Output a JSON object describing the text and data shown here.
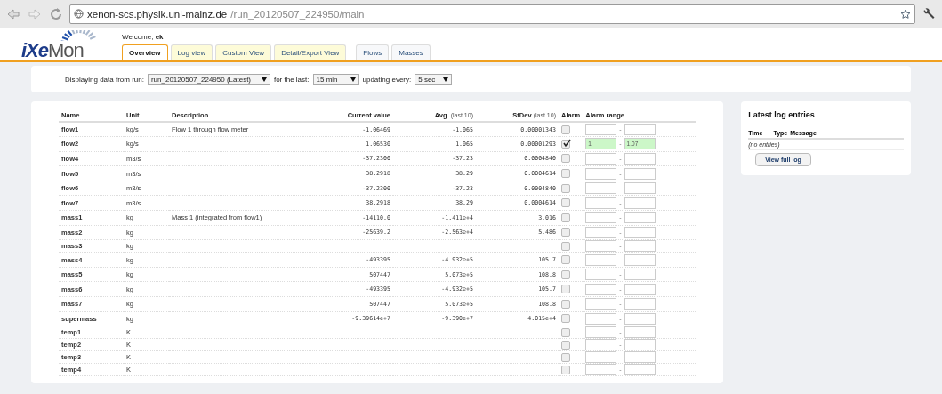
{
  "browser": {
    "url_host": "xenon-scs.physik.uni-mainz.de",
    "url_path": "/run_20120507_224950/main"
  },
  "header": {
    "logo": {
      "prefix": "iXe",
      "suffix": "Mon"
    },
    "welcome": "Welcome,",
    "user": "ek"
  },
  "tabs": [
    {
      "label": "Overview",
      "kind": "view",
      "selected": true
    },
    {
      "label": "Log view",
      "kind": "view",
      "selected": false
    },
    {
      "label": "Custom View",
      "kind": "view",
      "selected": false
    },
    {
      "label": "Detail/Export View",
      "kind": "view",
      "selected": false
    },
    {
      "label": "Flows",
      "kind": "group",
      "selected": false
    },
    {
      "label": "Masses",
      "kind": "group",
      "selected": false
    }
  ],
  "controls": {
    "run_label": "Displaying data from run:",
    "run": "run_20120507_224950 (Latest)",
    "last_label": "for the last:",
    "last": "15 min",
    "update_label": "updating every:",
    "update": "5 sec"
  },
  "table": {
    "columns": [
      {
        "label": "Name"
      },
      {
        "label": "Unit"
      },
      {
        "label": "Description"
      },
      {
        "label": "Current value"
      },
      {
        "label": "Avg.",
        "note": "(last 10)"
      },
      {
        "label": "StDev",
        "note": "(last 10)"
      },
      {
        "label": "Alarm"
      },
      {
        "label": "Alarm range"
      }
    ],
    "rows": [
      {
        "name": "flow1",
        "unit": "kg/s",
        "description": "Flow 1 through flow meter",
        "current": "-1.06469",
        "avg": "-1.065",
        "stdev": "0.00001343",
        "alarm": false,
        "separator": "-"
      },
      {
        "name": "flow2",
        "unit": "kg/s",
        "current": "1.06530",
        "avg": "1.065",
        "stdev": "0.00001293",
        "alarm": true,
        "alarm_low": "1",
        "separator": "-",
        "alarm_high": "1.07"
      },
      {
        "name": "flow4",
        "unit": "m3/s",
        "current": "-37.2300",
        "avg": "-37.23",
        "stdev": "0.0004840",
        "alarm": false,
        "separator": "-"
      },
      {
        "name": "flow5",
        "unit": "m3/s",
        "current": "38.2918",
        "avg": "38.29",
        "stdev": "0.0004614",
        "alarm": false,
        "separator": "-"
      },
      {
        "name": "flow6",
        "unit": "m3/s",
        "current": "-37.2300",
        "avg": "-37.23",
        "stdev": "0.0004840",
        "alarm": false,
        "separator": "-"
      },
      {
        "name": "flow7",
        "unit": "m3/s",
        "current": "38.2918",
        "avg": "38.29",
        "stdev": "0.0004614",
        "alarm": false,
        "separator": "-"
      },
      {
        "name": "mass1",
        "unit": "kg",
        "description": "Mass 1 (integrated from flow1)",
        "current": "-14110.0",
        "avg": "-1.411e+4",
        "stdev": "3.016",
        "alarm": false,
        "separator": "-"
      },
      {
        "name": "mass2",
        "unit": "kg",
        "current": "-25639.2",
        "avg": "-2.563e+4",
        "stdev": "5.486",
        "alarm": false,
        "separator": "-"
      },
      {
        "name": "mass3",
        "unit": "kg",
        "alarm": false,
        "separator": "-"
      },
      {
        "name": "mass4",
        "unit": "kg",
        "current": "-493395",
        "avg": "-4.932e+5",
        "stdev": "105.7",
        "alarm": false,
        "separator": "-"
      },
      {
        "name": "mass5",
        "unit": "kg",
        "current": "507447",
        "avg": "5.073e+5",
        "stdev": "108.8",
        "alarm": false,
        "separator": "-"
      },
      {
        "name": "mass6",
        "unit": "kg",
        "current": "-493395",
        "avg": "-4.932e+5",
        "stdev": "105.7",
        "alarm": false,
        "separator": "-"
      },
      {
        "name": "mass7",
        "unit": "kg",
        "current": "507447",
        "avg": "5.073e+5",
        "stdev": "108.8",
        "alarm": false,
        "separator": "-"
      },
      {
        "name": "supermass",
        "unit": "kg",
        "current": "-9.39614e+7",
        "avg": "-9.390e+7",
        "stdev": "4.015e+4",
        "alarm": false,
        "separator": "-"
      },
      {
        "name": "temp1",
        "unit": "K",
        "alarm": false,
        "separator": "-"
      },
      {
        "name": "temp2",
        "unit": "K",
        "alarm": false,
        "separator": "-"
      },
      {
        "name": "temp3",
        "unit": "K",
        "alarm": false,
        "separator": "-"
      },
      {
        "name": "temp4",
        "unit": "K",
        "alarm": false,
        "separator": "-"
      }
    ]
  },
  "log": {
    "title": "Latest log entries",
    "columns": [
      "Time",
      "Type",
      "Message"
    ],
    "empty": "(no entries)",
    "button": "View full log"
  }
}
